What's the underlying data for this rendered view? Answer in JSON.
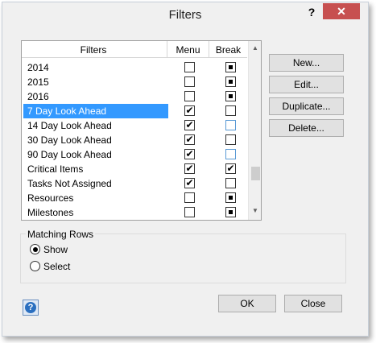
{
  "window": {
    "title": "Filters",
    "help_glyph": "?",
    "close_glyph": "✕"
  },
  "list": {
    "columns": [
      "Filters",
      "Menu",
      "Break"
    ],
    "rows": [
      {
        "name": "2014",
        "menu": false,
        "brk": "square",
        "selected": false,
        "brk_blue": false
      },
      {
        "name": "2015",
        "menu": false,
        "brk": "square",
        "selected": false,
        "brk_blue": false
      },
      {
        "name": "2016",
        "menu": false,
        "brk": "square",
        "selected": false,
        "brk_blue": false
      },
      {
        "name": "7 Day Look Ahead",
        "menu": true,
        "brk": "empty",
        "selected": true,
        "brk_blue": false
      },
      {
        "name": "14 Day Look Ahead",
        "menu": true,
        "brk": "empty",
        "selected": false,
        "brk_blue": true
      },
      {
        "name": "30 Day Look Ahead",
        "menu": true,
        "brk": "empty",
        "selected": false,
        "brk_blue": false
      },
      {
        "name": "90 Day Look Ahead",
        "menu": true,
        "brk": "empty",
        "selected": false,
        "brk_blue": true
      },
      {
        "name": "Critical Items",
        "menu": true,
        "brk": "check",
        "selected": false,
        "brk_blue": false
      },
      {
        "name": "Tasks Not Assigned",
        "menu": true,
        "brk": "empty",
        "selected": false,
        "brk_blue": false
      },
      {
        "name": "Resources",
        "menu": false,
        "brk": "square",
        "selected": false,
        "brk_blue": false
      },
      {
        "name": "Milestones",
        "menu": false,
        "brk": "square",
        "selected": false,
        "brk_blue": false
      }
    ],
    "scroll_up_glyph": "▲",
    "scroll_down_glyph": "▼"
  },
  "buttons": {
    "new": "New...",
    "edit": "Edit...",
    "duplicate": "Duplicate...",
    "delete": "Delete...",
    "ok": "OK",
    "close": "Close"
  },
  "matching_rows": {
    "label": "Matching Rows",
    "show": "Show",
    "select": "Select",
    "selected": "show"
  },
  "icons": {
    "help_button_icon": "help-icon",
    "help_glyph": "?"
  }
}
